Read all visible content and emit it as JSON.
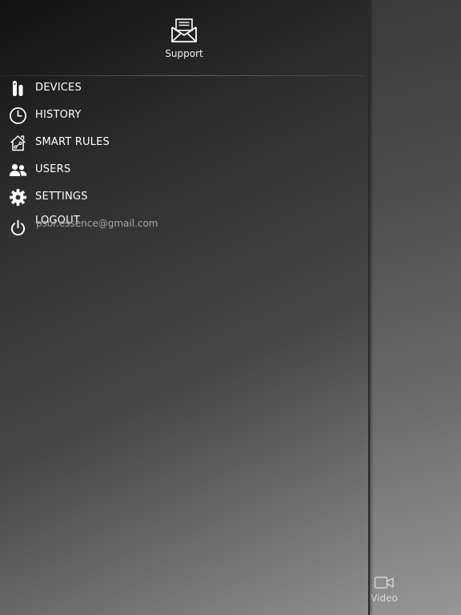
{
  "header": {
    "support_label": "Support"
  },
  "menu": {
    "items": [
      {
        "label": "DEVICES",
        "icon": "device-sensor-icon"
      },
      {
        "label": "HISTORY",
        "icon": "clock-icon"
      },
      {
        "label": "SMART RULES",
        "icon": "smart-home-icon"
      },
      {
        "label": "USERS",
        "icon": "users-icon"
      },
      {
        "label": "SETTINGS",
        "icon": "gear-icon"
      },
      {
        "label": "LOGOUT",
        "icon": "power-icon"
      }
    ]
  },
  "account": {
    "email": "psor.essence@gmail.com"
  },
  "bottom_nav": {
    "video_label": "Video"
  },
  "colors": {
    "text": "#ffffff",
    "muted_text": "#a6a6a6"
  }
}
